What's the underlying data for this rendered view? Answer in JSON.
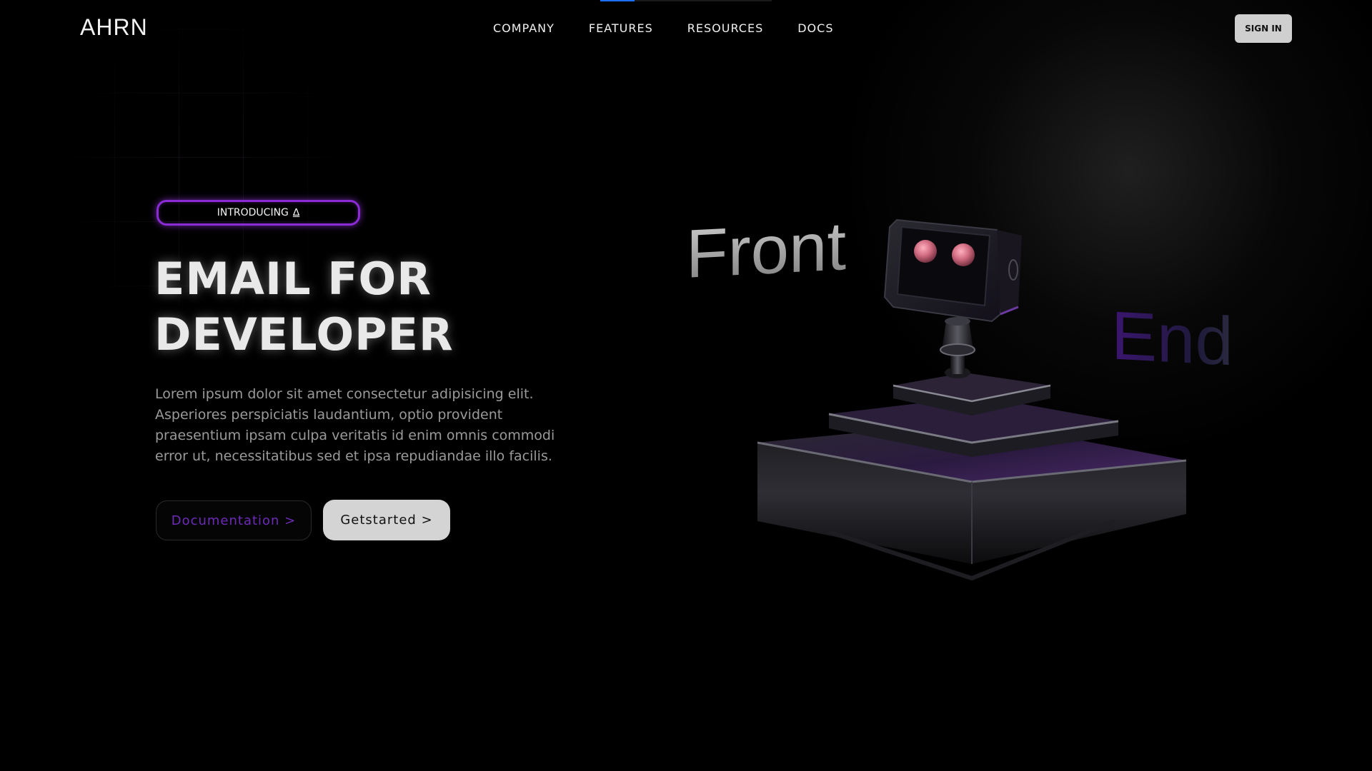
{
  "brand": {
    "logo": "AHRN"
  },
  "nav": {
    "items": [
      {
        "label": "COMPANY"
      },
      {
        "label": "FEATURES"
      },
      {
        "label": "RESOURCES"
      },
      {
        "label": "DOCS"
      }
    ],
    "signin_label": "SIGN IN"
  },
  "hero": {
    "badge_label": "INTRODUCING",
    "badge_mark": "∆",
    "headline_line1": "EMAIL FOR",
    "headline_line2": "DEVELOPER",
    "description": "Lorem ipsum dolor sit amet consectetur adipisicing elit. Asperiores perspiciatis laudantium, optio provident praesentium ipsam culpa veritatis id enim omnis commodi error ut, necessitatibus sed et ipsa repudiandae illo facilis.",
    "doc_button_label": "Documentation >",
    "start_button_label": "Getstarted >"
  },
  "art": {
    "word_front": "Front",
    "word_end": "End",
    "illustration": "robot-on-pedestal",
    "accent_color": "#8a2bd6"
  },
  "colors": {
    "background": "#000000",
    "accent_purple": "#8a2bd6",
    "doc_text": "#6d2bb8",
    "top_indicator": "#1d6fff"
  }
}
